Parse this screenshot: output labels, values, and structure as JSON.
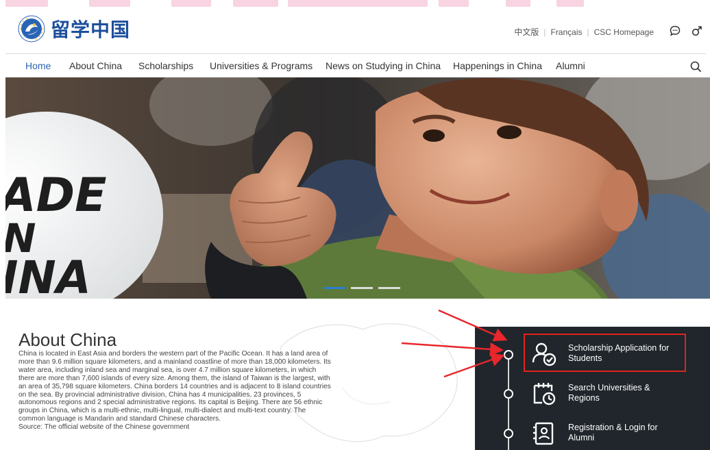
{
  "brand": {
    "logo_text": "留学中国"
  },
  "utility_links": [
    "中文版",
    "Français",
    "CSC Homepage"
  ],
  "icons": {
    "chat": "chat-bubble-icon",
    "gender": "gender-icon",
    "search": "search-icon"
  },
  "nav": {
    "items": [
      {
        "label": "Home",
        "active": true
      },
      {
        "label": "About China"
      },
      {
        "label": "Scholarships"
      },
      {
        "label": "Universities & Programs"
      },
      {
        "label": "News on Studying in China"
      },
      {
        "label": "Happenings in China"
      },
      {
        "label": "Alumni"
      }
    ]
  },
  "hero": {
    "plate_text": [
      "ADE",
      "N",
      "INA"
    ],
    "slides": 3,
    "active_slide": 1
  },
  "about": {
    "title": "About China",
    "body": "China is located in East Asia and borders the western part of the Pacific Ocean. It has a land area of more than 9.6 million square kilometers, and a mainland coastline of more than 18,000 kilometers. Its water area, including inland sea and marginal sea, is over 4.7 million square kilometers, in which there are more than 7,600 islands of every size. Among them, the island of Taiwan is the largest, with an area of 35,798 square kilometers. China borders 14 countries and is adjacent to 8 island countries on the sea. By provincial administrative division, China has 4 municipalities, 23 provinces, 5 autonomous regions and 2 special administrative regions. Its capital is Beijing. There are 56 ethnic groups in China, which is a multi-ethnic, multi-lingual, multi-dialect and multi-text country. The common language is Mandarin and standard Chinese characters.",
    "source": "Source: The official website of the Chinese government"
  },
  "services": [
    {
      "label_1": "Scholarship Application for",
      "label_2": "Students",
      "icon": "scholarship-user-check-icon"
    },
    {
      "label_1": "Search Universities &",
      "label_2": "Regions",
      "icon": "calendar-clock-icon"
    },
    {
      "label_1": "Registration & Login for",
      "label_2": "Alumni",
      "icon": "id-card-icon"
    }
  ],
  "colors": {
    "accent": "#2a64b5",
    "highlight": "#e2231a",
    "annotation_arrow": "#e8262b",
    "panel_bg": "#20262c"
  }
}
